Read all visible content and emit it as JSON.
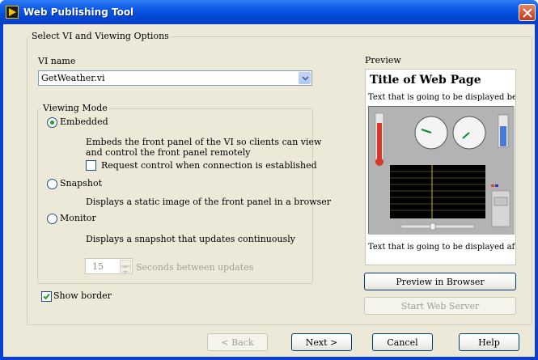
{
  "window": {
    "title": "Web Publishing Tool",
    "close_glyph": "close-icon"
  },
  "main_group": {
    "label": "Select VI and Viewing Options"
  },
  "vi_name": {
    "label": "VI name",
    "value": "GetWeather.vi"
  },
  "viewing_mode": {
    "label": "Viewing Mode",
    "options": [
      {
        "label": "Embedded",
        "selected": true,
        "description": [
          "Embeds the front panel of the VI so clients can view",
          "and control the front panel remotely"
        ]
      },
      {
        "label": "Snapshot",
        "selected": false,
        "description": [
          "Displays a static image of the front panel in a browser"
        ]
      },
      {
        "label": "Monitor",
        "selected": false,
        "description": [
          "Displays a snapshot that updates continuously"
        ]
      }
    ],
    "request_control": {
      "label": "Request control when connection is established",
      "checked": false
    },
    "update_interval": {
      "value": "15",
      "label": "Seconds between updates"
    }
  },
  "show_border": {
    "label": "Show border",
    "checked": true
  },
  "preview": {
    "label": "Preview",
    "page_title": "Title of Web Page",
    "text_before": "Text that is going to be displayed bef...",
    "text_after": "Text that is going to be displayed afte...",
    "preview_button": "Preview in Browser",
    "start_server_button": "Start Web Server"
  },
  "footer": {
    "back": "< Back",
    "next": "Next >",
    "cancel": "Cancel",
    "help": "Help"
  },
  "colors": {
    "titlebar": "#0a3fd3",
    "dialog_bg": "#ece9d8",
    "radio_selected": "#21a121",
    "check_mark": "#21a121"
  }
}
